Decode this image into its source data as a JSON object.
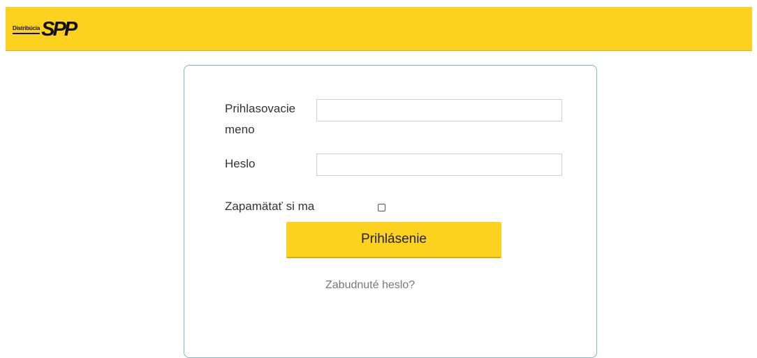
{
  "header": {
    "logo_small_text": "Distribúcia",
    "logo_big_text": "SPP",
    "brand_color": "#fdd21f"
  },
  "login_form": {
    "username_label_line1": "Prihlasovacie",
    "username_label_line2": "meno",
    "username_value": "",
    "password_label": "Heslo",
    "password_value": "",
    "remember_label": "Zapamätať si ma",
    "remember_checked": false,
    "submit_label": "Prihlásenie",
    "forgot_link": "Zabudnuté heslo?"
  }
}
